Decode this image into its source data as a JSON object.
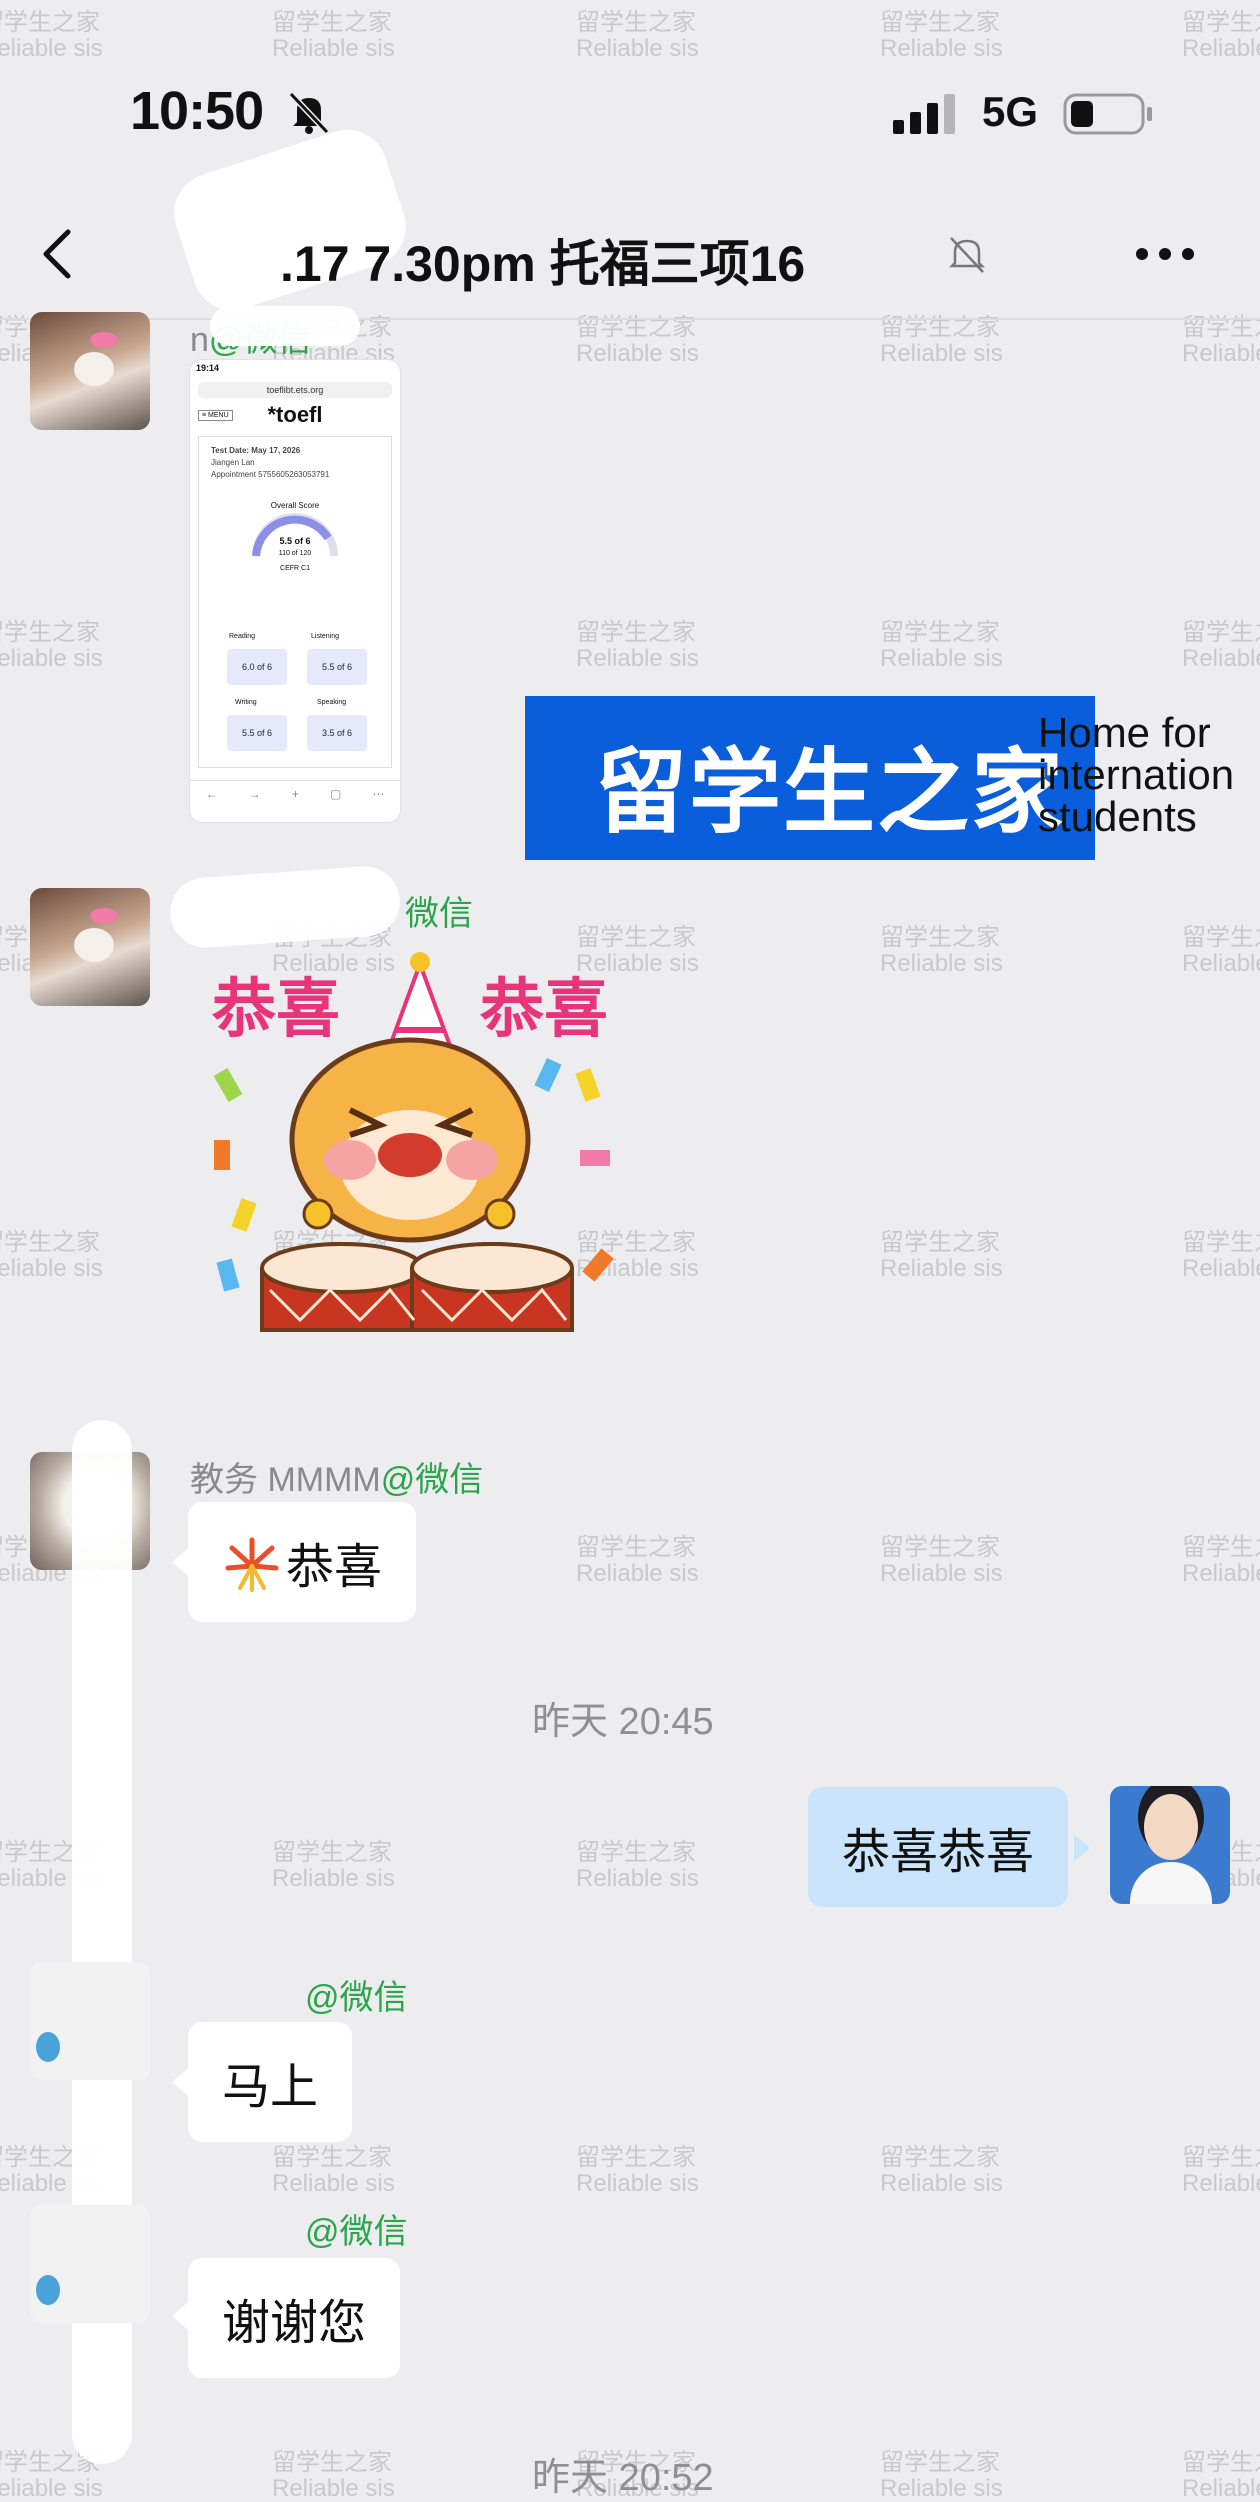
{
  "status_bar": {
    "time": "10:50",
    "network": "5G"
  },
  "nav": {
    "title": ".17 7.30pm 托福三项16"
  },
  "messages": {
    "m1": {
      "sender_visible": "n",
      "sender_wx": "@微信"
    },
    "screenshot": {
      "time": "19:14",
      "url": "toeflibt.ets.org",
      "brand": "*toefl",
      "menu": "≡ MENU",
      "test_date": "Test Date: May 17, 2026",
      "name": "Jiangen Lan",
      "appointment": "Appointment 5755605263053791",
      "overall_label": "Overall Score",
      "overall": "5.5 of 6",
      "of120": "110 of 120",
      "cefr": "CEFR C1",
      "reading_label": "Reading",
      "listening_label": "Listening",
      "reading": "6.0 of 6",
      "listening": "5.5 of 6",
      "writing_label": "Writing",
      "speaking_label": "Speaking",
      "writing": "5.5 of 6",
      "speaking": "3.5 of 6"
    },
    "banner": {
      "cn": "留学生之家",
      "en1": "Home for",
      "en2": "internation",
      "en3": "students"
    },
    "m2": {
      "sender_wx": "微信",
      "sticker_left": "恭喜",
      "sticker_right": "恭喜"
    },
    "m3": {
      "sender": "教务 MMMM",
      "sender_wx": "@微信",
      "text": "恭喜"
    },
    "time1": "昨天 20:45",
    "m4": {
      "text": "恭喜恭喜"
    },
    "m5": {
      "sender_wx": "@微信",
      "text": "马上"
    },
    "m6": {
      "sender_wx": "@微信",
      "text": "谢谢您"
    },
    "time2": "昨天 20:52"
  },
  "watermark": {
    "cn": "留学生之家",
    "en": "Reliable sis"
  }
}
